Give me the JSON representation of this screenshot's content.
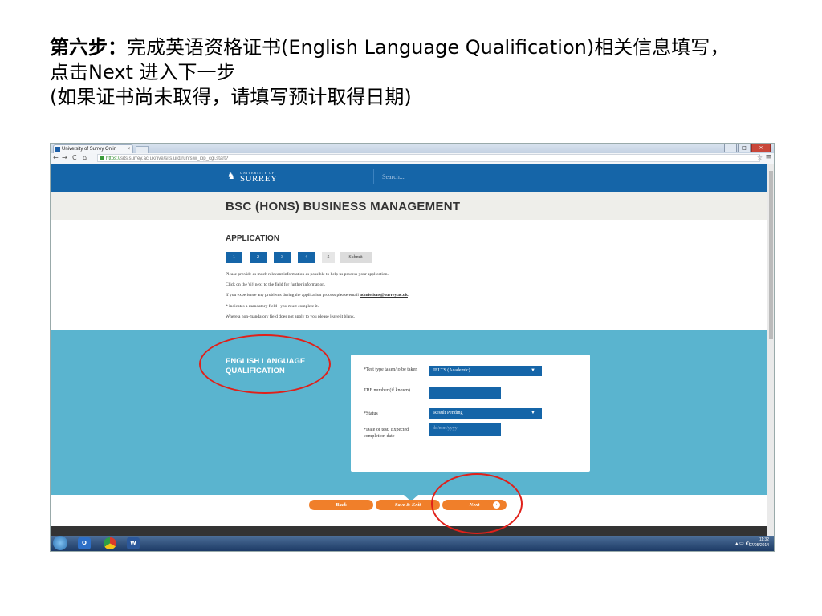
{
  "caption": {
    "line1_bold": "第六步：",
    "line1_rest": "完成英语资格证书(English Language Qualification)相关信息填写，",
    "line2": "点击Next 进入下一步",
    "line3": "(如果证书尚未取得，请填写预计取得日期)"
  },
  "browser": {
    "tab_title": "University of Surrey Onlin",
    "tab_close": "×",
    "url_https": "https://",
    "url_rest": "sits.surrey.ac.uk/live/sits.urd/run/siw_ipp_cgi.start?"
  },
  "site": {
    "logo_small": "UNIVERSITY OF",
    "logo_big": "SURREY",
    "search_placeholder": "Search...",
    "programme_title": "BSC (HONS) BUSINESS MANAGEMENT"
  },
  "application": {
    "heading": "APPLICATION",
    "steps": [
      "1",
      "2",
      "3",
      "4",
      "5"
    ],
    "submit_label": "Submit",
    "help": {
      "line1": "Please provide as much relevant information as possible to help us process your application.",
      "line2": "Click on the '(i)' next to the field for further information.",
      "line3_pre": "If you experience any problems during the application process please email ",
      "line3_email": "admissions@surrey.ac.uk",
      "line3_post": ".",
      "line4": "* indicates a mandatory field - you must complete it.",
      "line5": "Where a non-mandatory field does not apply to you please leave it blank."
    }
  },
  "section": {
    "title": "ENGLISH LANGUAGE QUALIFICATION",
    "fields": {
      "test_type_label": "*Test type taken/to be taken",
      "test_type_value": "IELTS (Academic)",
      "trf_label": "TRF number (if known)",
      "trf_value": "",
      "status_label": "*Status",
      "status_value": "Result Pending",
      "date_label": "*Date of test/ Expected completion date",
      "date_placeholder": "dd/mm/yyyy"
    },
    "dropdown_arrow": "▼"
  },
  "buttons": {
    "back": "Back",
    "save_exit": "Save & Exit",
    "next": "Next",
    "next_icon": "›"
  },
  "taskbar": {
    "time": "11:32",
    "date": "07/05/2014"
  },
  "colors": {
    "header_blue": "#1565a8",
    "panel_teal": "#5ab4cf",
    "button_orange": "#f07f2a",
    "annotation_red": "#e0201a"
  }
}
